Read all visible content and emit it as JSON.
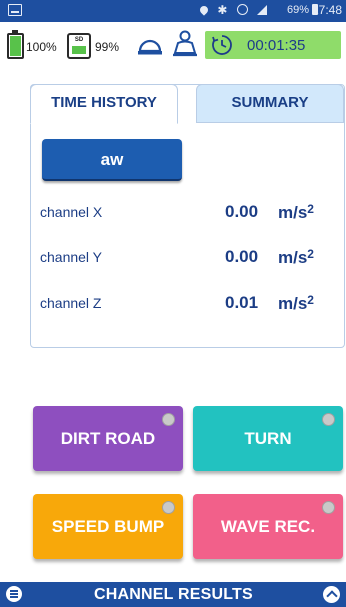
{
  "status_bar": {
    "signal_pct": "69%",
    "time": "17:48",
    "icons": [
      "notification-icon",
      "location-icon",
      "bluetooth-icon",
      "alarm-icon",
      "signal-icon",
      "battery-icon"
    ]
  },
  "top_bar": {
    "battery_pct": "100%",
    "sd_label": "SD",
    "sd_pct": "99%",
    "timer": "00:01:35",
    "icons": [
      "battery-icon",
      "sd-card-icon",
      "dome-light-icon",
      "seat-icon",
      "timer-icon"
    ],
    "colors": {
      "battery_fill": "#58c24a",
      "timer_bg": "#8fdc6a"
    }
  },
  "tabs": [
    {
      "label": "TIME HISTORY",
      "active": true
    },
    {
      "label": "SUMMARY",
      "active": false
    }
  ],
  "measure_button": {
    "label": "aw"
  },
  "channels": [
    {
      "label": "channel X",
      "value": "0.00",
      "unit": "m/s",
      "unit_exp": "2"
    },
    {
      "label": "channel Y",
      "value": "0.00",
      "unit": "m/s",
      "unit_exp": "2"
    },
    {
      "label": "channel Z",
      "value": "0.01",
      "unit": "m/s",
      "unit_exp": "2"
    }
  ],
  "event_buttons": [
    {
      "label": "DIRT ROAD",
      "color": "#8e4fbf"
    },
    {
      "label": "TURN",
      "color": "#22c2c0"
    },
    {
      "label": "SPEED BUMP",
      "color": "#f8a80a"
    },
    {
      "label": "WAVE REC.",
      "color": "#f2608a"
    }
  ],
  "bottom_bar": {
    "title": "CHANNEL RESULTS",
    "icons": [
      "menu-icon",
      "chevron-up-icon"
    ]
  },
  "colors": {
    "primary": "#1e4fa0",
    "accent_text": "#1c3d85",
    "tab_inactive_bg": "#d2e8fb"
  }
}
